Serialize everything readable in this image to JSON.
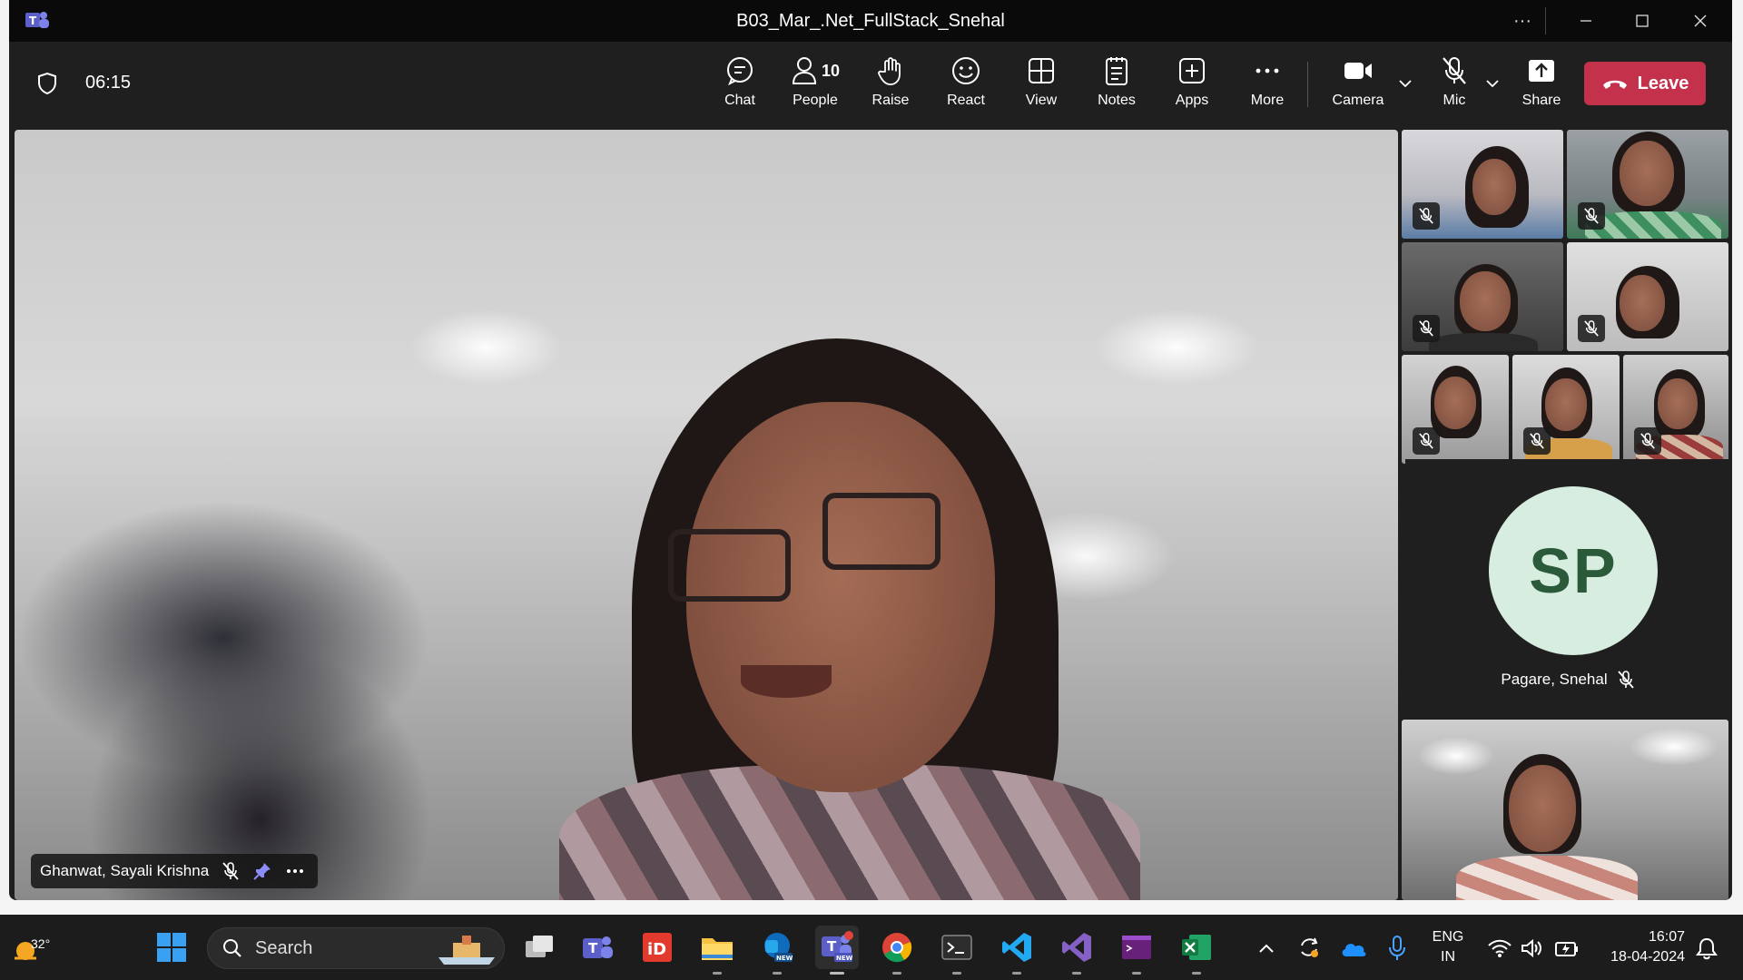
{
  "window": {
    "title": "B03_Mar_.Net_FullStack_Snehal",
    "more_label": "···"
  },
  "meeting": {
    "timer": "06:15"
  },
  "toolbar": {
    "chat": "Chat",
    "people": "People",
    "people_count": "10",
    "raise": "Raise",
    "react": "React",
    "view": "View",
    "notes": "Notes",
    "apps": "Apps",
    "more": "More",
    "camera": "Camera",
    "mic": "Mic",
    "share": "Share",
    "leave": "Leave"
  },
  "main_speaker": {
    "name": "Ghanwat, Sayali Krishna"
  },
  "participants": {
    "avatar_initials": "SP",
    "avatar_name": "Pagare, Snehal"
  },
  "taskbar": {
    "weather_temp": "32°",
    "search_placeholder": "Search",
    "lang_line1": "ENG",
    "lang_line2": "IN",
    "time": "16:07",
    "date": "18-04-2024"
  },
  "colors": {
    "leave": "#c4314b",
    "avatar_bg": "#d6ede0",
    "avatar_text": "#2b5a3a",
    "toolbar_bg": "#1f1f1f"
  }
}
